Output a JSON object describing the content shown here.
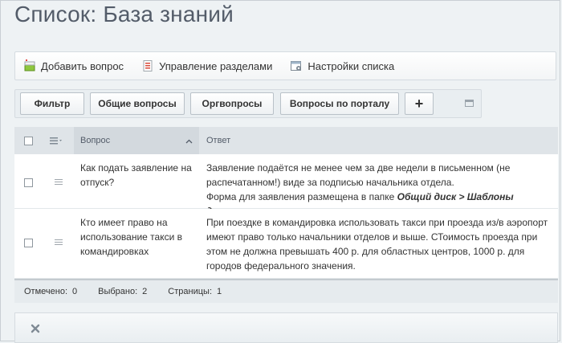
{
  "page": {
    "title": "Список: База знаний"
  },
  "toolbar": {
    "add_question": "Добавить вопрос",
    "manage_sections": "Управление разделами",
    "list_settings": "Настройки списка"
  },
  "filter": {
    "filter_button": "Фильтр",
    "general_questions": "Общие вопросы",
    "org_questions": "Оргвопросы",
    "portal_questions": "Вопросы по порталу",
    "add_symbol": "+"
  },
  "grid": {
    "columns": {
      "question": "Вопрос",
      "answer": "Ответ"
    },
    "rows": [
      {
        "question": "Как подать заявление на отпуск?",
        "answer_line1": "Заявление подаётся не менее чем за две недели в письменном (не распечатанном!) виде за подписью начальника отдела.",
        "answer_line2_prefix": "Форма для заявления размещена в папке ",
        "answer_line2_em": "Общий диск > Шаблоны документов",
        "answer_line2_suffix": "."
      },
      {
        "question": "Кто имеет право на использование такси в командировках",
        "answer_line1": "При поездке в командировка использовать такси при проезда из/в аэропорт имеют право только начальники отделов и выше. СТоимость проезда при этом не должна превышать 400 р. для областных центров, 1000 р. для городов федерального значения."
      }
    ]
  },
  "footer": {
    "marked_label": "Отмечено:",
    "marked_value": "0",
    "selected_label": "Выбрано:",
    "selected_value": "2",
    "pages_label": "Страницы:",
    "pages_value": "1"
  },
  "colors": {
    "title": "#535c69",
    "header_bg": "#dfe4e8",
    "page_bg": "#eef2f4"
  },
  "icons": [
    "add-question-icon",
    "manage-sections-icon",
    "list-settings-icon",
    "expand-icon",
    "column-menu-icon",
    "sort-asc-icon",
    "row-menu-icon",
    "close-icon"
  ]
}
